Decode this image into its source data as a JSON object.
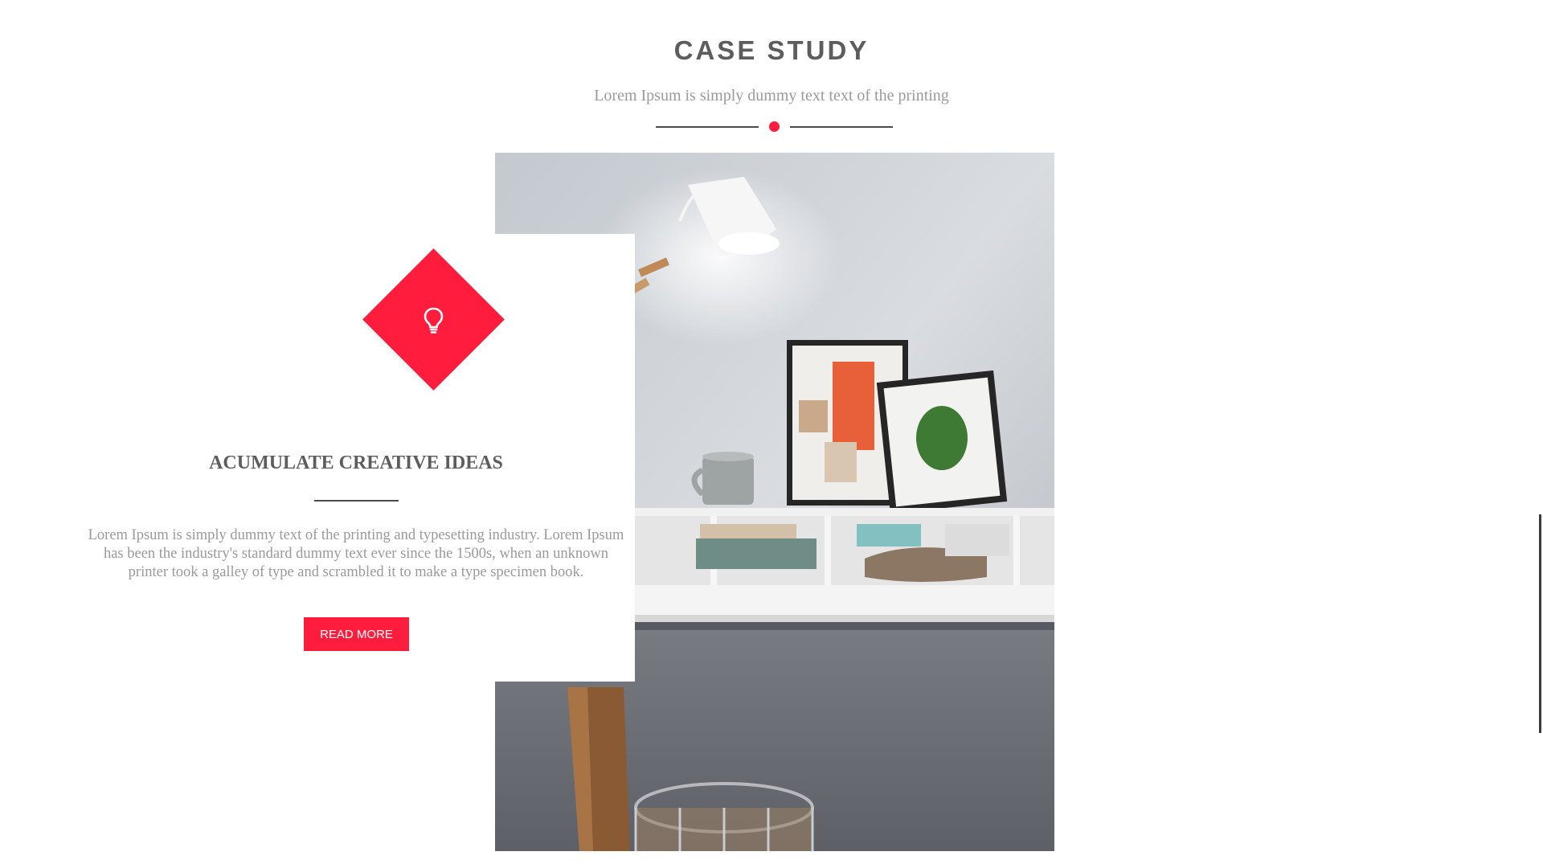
{
  "section": {
    "title": "CASE STUDY",
    "subtitle": "Lorem Ipsum is simply dummy text text of the printing"
  },
  "card": {
    "icon": "lightbulb-icon",
    "title": "ACUMULATE CREATIVE IDEAS",
    "body": "Lorem Ipsum is simply dummy text of the printing and typesetting industry. Lorem Ipsum has been the industry's standard dummy text ever since the 1500s, when an unknown printer took a galley of type and scrambled it to make a type specimen book.",
    "button_label": "READ MORE"
  },
  "colors": {
    "accent": "#ff1c3c",
    "heading": "#5d5d5d",
    "muted_text": "#9a9a9a",
    "rule": "#4a4a4a"
  }
}
